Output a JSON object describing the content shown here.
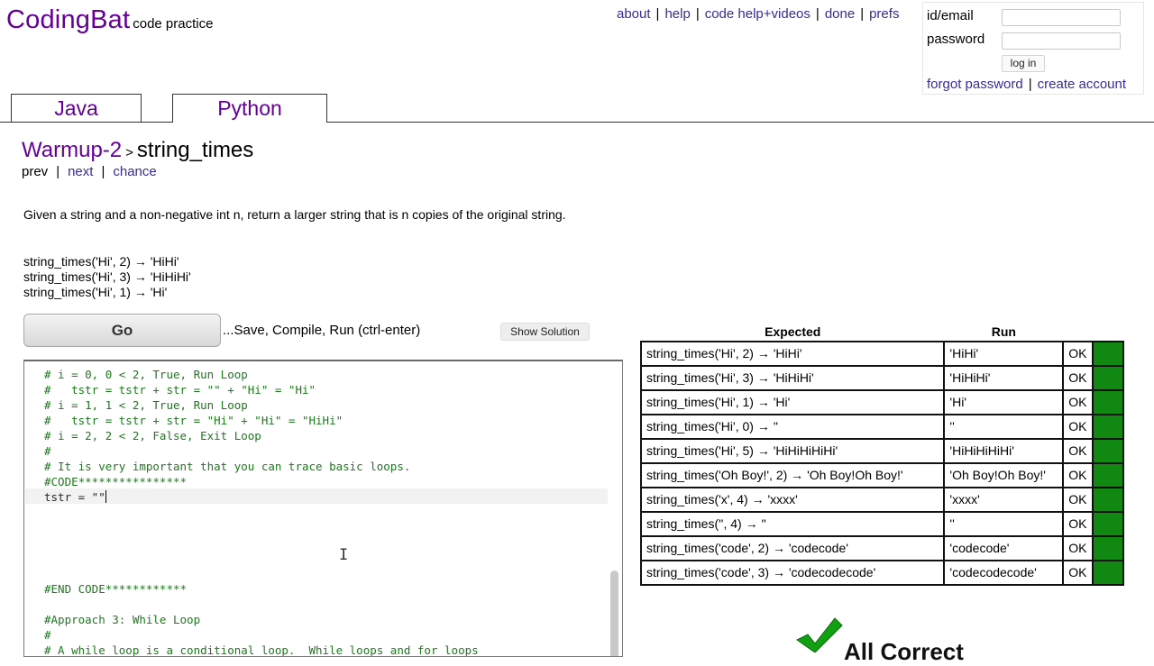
{
  "logo": {
    "brand": "CodingBat",
    "tagline": "code practice"
  },
  "topnav": [
    "about",
    "help",
    "code help+videos",
    "done",
    "prefs"
  ],
  "login": {
    "id_label": "id/email",
    "password_label": "password",
    "login_button": "log in",
    "forgot": "forgot password",
    "create": "create account"
  },
  "tabs": {
    "java": "Java",
    "python": "Python"
  },
  "breadcrumb": {
    "section": "Warmup-2",
    "sep": ">",
    "problem": "string_times"
  },
  "subnav": {
    "prev": "prev",
    "next": "next",
    "chance": "chance"
  },
  "description": "Given a string and a non-negative int n, return a larger string that is n copies of the original string.",
  "examples": [
    "string_times('Hi', 2) → 'HiHi'",
    "string_times('Hi', 3) → 'HiHiHi'",
    "string_times('Hi', 1) → 'Hi'"
  ],
  "go": {
    "label": "Go",
    "hint": "...Save, Compile, Run (ctrl-enter)",
    "solution": "Show Solution"
  },
  "editor": {
    "lines": [
      {
        "text": "# i = 0, 0 < 2, True, Run Loop",
        "kind": "c"
      },
      {
        "text": "#   tstr = tstr + str = \"\" + \"Hi\" = \"Hi\"",
        "kind": "c"
      },
      {
        "text": "# i = 1, 1 < 2, True, Run Loop",
        "kind": "c"
      },
      {
        "text": "#   tstr = tstr + str = \"Hi\" + \"Hi\" = \"HiHi\"",
        "kind": "c"
      },
      {
        "text": "# i = 2, 2 < 2, False, Exit Loop",
        "kind": "c"
      },
      {
        "text": "#",
        "kind": "c"
      },
      {
        "text": "# It is very important that you can trace basic loops.",
        "kind": "c"
      },
      {
        "text": "#CODE****************",
        "kind": "c"
      },
      {
        "text": "tstr = \"\"",
        "kind": "k"
      },
      {
        "text": "",
        "kind": "k"
      },
      {
        "text": "",
        "kind": "k"
      },
      {
        "text": "",
        "kind": "k"
      },
      {
        "text": "",
        "kind": "k"
      },
      {
        "text": "",
        "kind": "k"
      },
      {
        "text": "#END CODE************",
        "kind": "c"
      },
      {
        "text": "",
        "kind": "k"
      },
      {
        "text": "#Approach 3: While Loop",
        "kind": "c"
      },
      {
        "text": "#",
        "kind": "c"
      },
      {
        "text": "# A while loop is a conditional loop.  While loops and for loops",
        "kind": "c"
      }
    ]
  },
  "results": {
    "headers": [
      "Expected",
      "Run",
      "",
      ""
    ],
    "rows": [
      [
        "string_times('Hi', 2) → 'HiHi'",
        "'HiHi'",
        "OK"
      ],
      [
        "string_times('Hi', 3) → 'HiHiHi'",
        "'HiHiHi'",
        "OK"
      ],
      [
        "string_times('Hi', 1) → 'Hi'",
        "'Hi'",
        "OK"
      ],
      [
        "string_times('Hi', 0) → ''",
        "''",
        "OK"
      ],
      [
        "string_times('Hi', 5) → 'HiHiHiHiHi'",
        "'HiHiHiHiHi'",
        "OK"
      ],
      [
        "string_times('Oh Boy!', 2) → 'Oh Boy!Oh Boy!'",
        "'Oh Boy!Oh Boy!'",
        "OK"
      ],
      [
        "string_times('x', 4) → 'xxxx'",
        "'xxxx'",
        "OK"
      ],
      [
        "string_times('', 4) → ''",
        "''",
        "OK"
      ],
      [
        "string_times('code', 2) → 'codecode'",
        "'codecode'",
        "OK"
      ],
      [
        "string_times('code', 3) → 'codecodecode'",
        "'codecodecode'",
        "OK"
      ]
    ]
  },
  "status": {
    "text": "All Correct"
  },
  "colors": {
    "brand": "#660099",
    "link": "#3a2a9a",
    "pass": "#118811",
    "comment": "#1d7a1d"
  }
}
